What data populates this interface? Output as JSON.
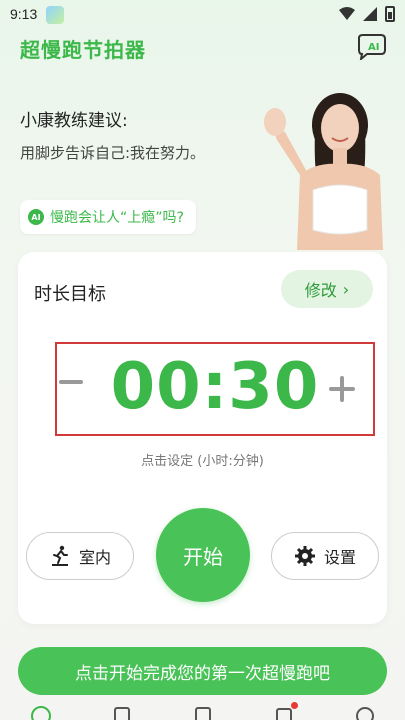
{
  "status_bar": {
    "time": "9:13"
  },
  "header": {
    "app_title": "超慢跑节拍器",
    "ai_icon_label": "AI"
  },
  "coach": {
    "title": "小康教练建议:",
    "message": "用脚步告诉自己:我在努力。",
    "ai_question": "慢跑会让人“上瘾”吗?",
    "ai_badge": "AI"
  },
  "card": {
    "title": "时长目标",
    "modify_label": "修改",
    "time_value": "00:30",
    "hint": "点击设定 (小时:分钟)",
    "indoor_label": "室内",
    "start_label": "开始",
    "settings_label": "设置"
  },
  "cta": {
    "label": "点击开始完成您的第一次超慢跑吧"
  },
  "tab_bar": {
    "items": [
      {
        "icon": "run-icon"
      },
      {
        "icon": "calendar-icon"
      },
      {
        "icon": "stats-icon"
      },
      {
        "icon": "shop-icon",
        "badge": true
      },
      {
        "icon": "chat-icon"
      }
    ]
  },
  "colors": {
    "accent": "#3cb84a",
    "highlight_border": "#d23a3a"
  }
}
